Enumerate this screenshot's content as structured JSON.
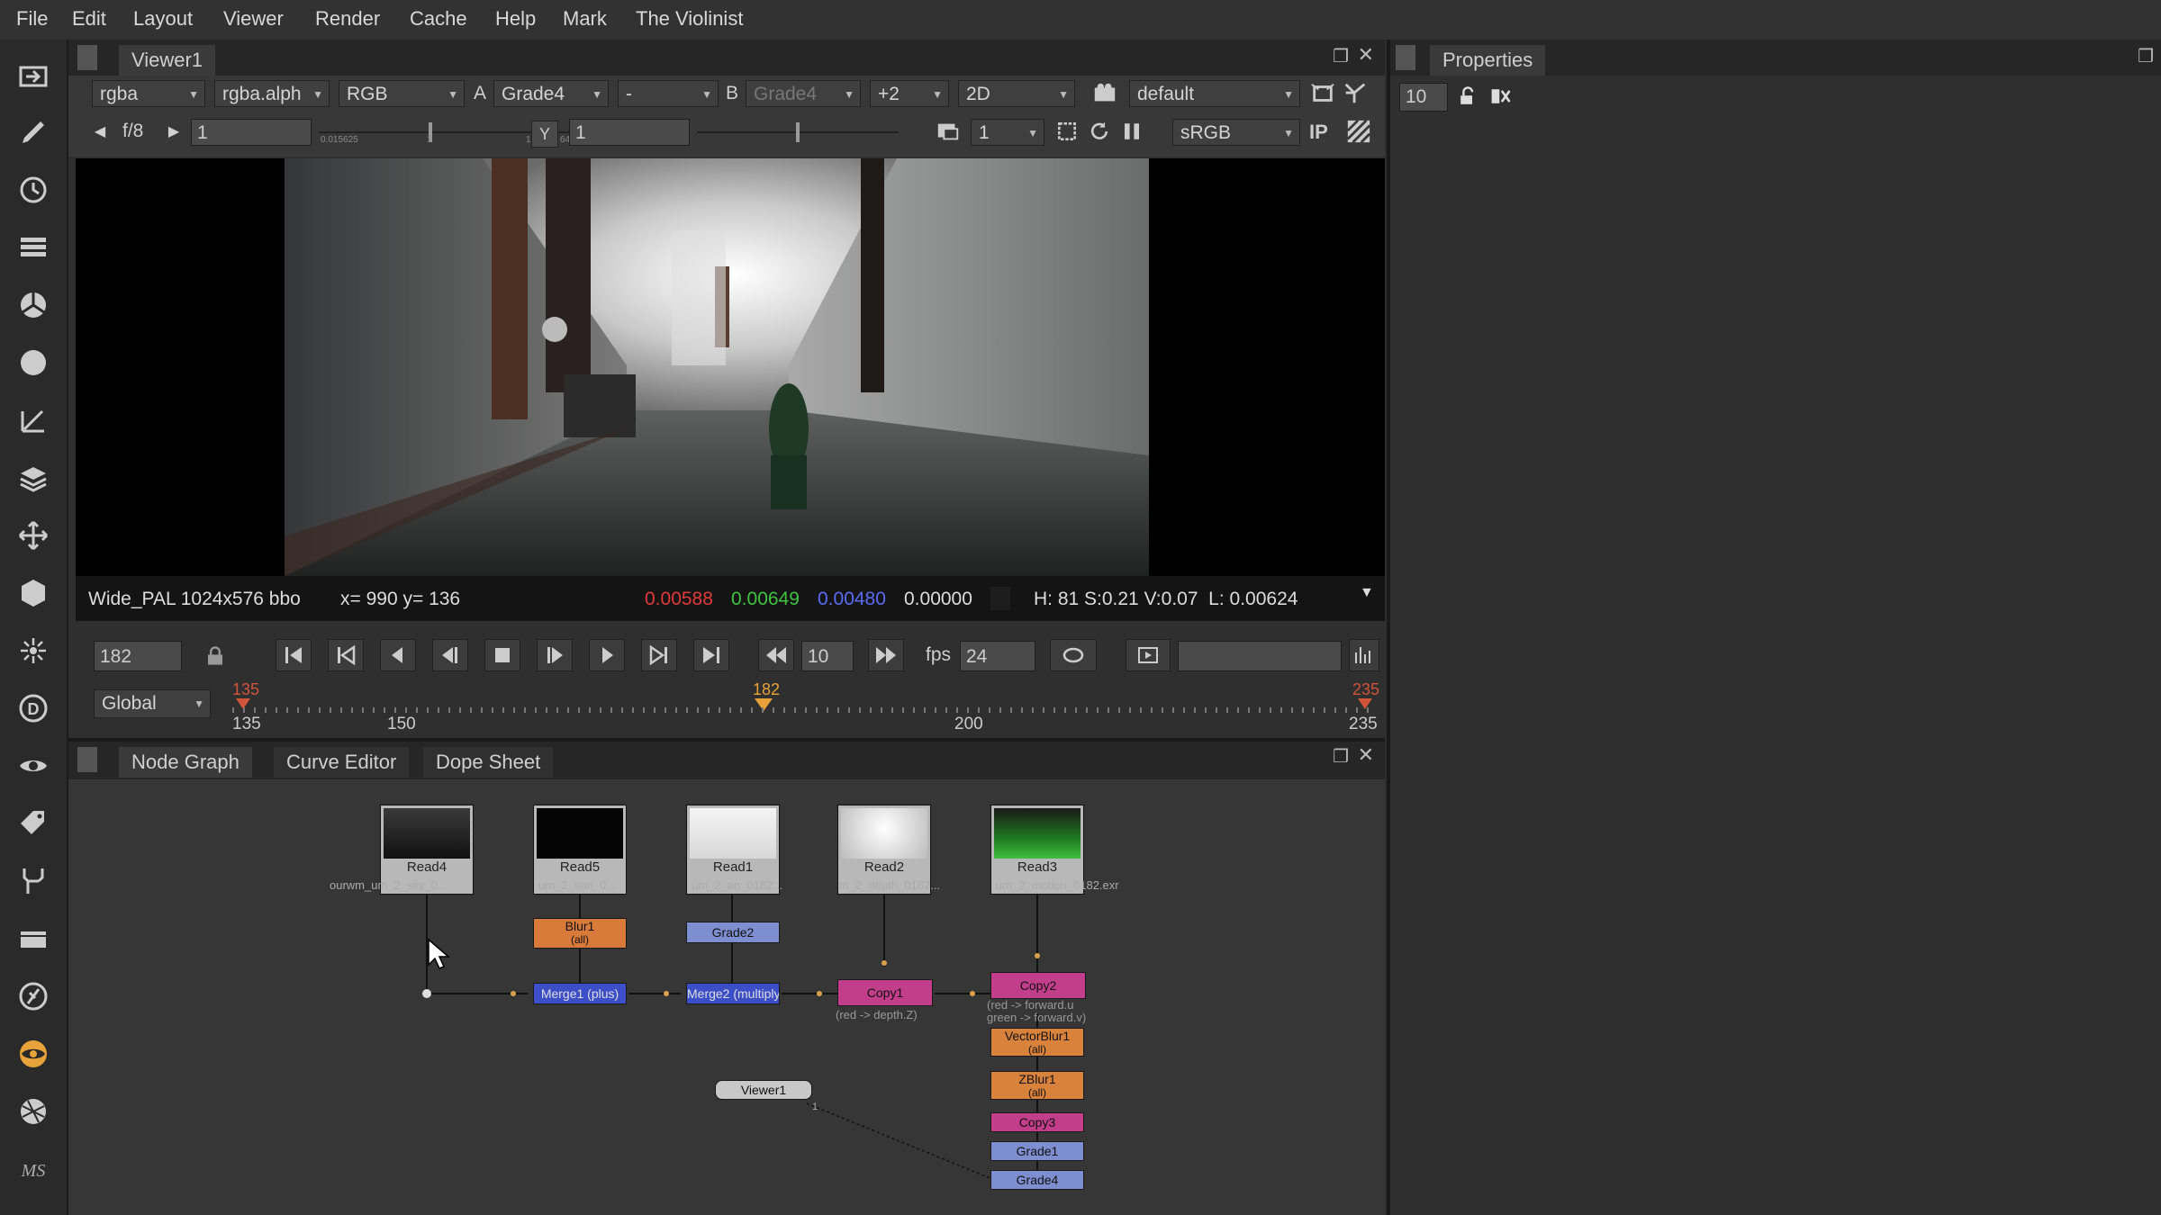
{
  "menu": [
    "File",
    "Edit",
    "Layout",
    "Viewer",
    "Render",
    "Cache",
    "Help",
    "Mark",
    "The Violinist"
  ],
  "viewer": {
    "tab": "Viewer1",
    "row1": {
      "channels": "rgba",
      "alpha": "rgba.alph",
      "display": "RGB",
      "a_label": "A",
      "a_input": "Grade4",
      "comp": "-",
      "b_label": "B",
      "b_input": "Grade4",
      "downrez": "+2",
      "view_mode": "2D",
      "lut_view": "default"
    },
    "row2": {
      "fstop": "f/8",
      "gain": "1",
      "gain_ticks": [
        "0.015625",
        "1",
        "16",
        "64"
      ],
      "y_label": "Y",
      "gamma": "1",
      "proxy": "1",
      "colorspace": "sRGB",
      "ip": "IP"
    },
    "status": {
      "format": "Wide_PAL 1024x576 bbo",
      "coords": "x= 990 y= 136",
      "r": "0.00588",
      "g": "0.00649",
      "b": "0.00480",
      "a": "0.00000",
      "hsvl": "H: 81 S:0.21 V:0.07  L: 0.00624"
    }
  },
  "timeline": {
    "frame": "182",
    "increment": "10",
    "fps_label": "fps",
    "fps": "24",
    "scope": "Global",
    "in_mark": "135",
    "current": "182",
    "out_mark": "235",
    "ticks": [
      "135",
      "150",
      "200",
      "235"
    ]
  },
  "properties": {
    "tab": "Properties",
    "max_panels": "10"
  },
  "nodegraph": {
    "tabs": [
      "Node Graph",
      "Curve Editor",
      "Dope Sheet"
    ],
    "reads": [
      {
        "name": "Read4",
        "sub": "ourwm_um_2_sky_0..."
      },
      {
        "name": "Read5",
        "sub": "um_2_sun_0..."
      },
      {
        "name": "Read1",
        "sub": "um_2_ao_0182..."
      },
      {
        "name": "Read2",
        "sub": "m_2_depth_0182..."
      },
      {
        "name": "Read3",
        "sub": "um_2_motion_0182.exr"
      }
    ],
    "nodes": {
      "blur1": "Blur1",
      "blur1_sub": "(all)",
      "grade2": "Grade2",
      "merge1": "Merge1 (plus)",
      "merge2": "Merge2 (multiply)",
      "copy1": "Copy1",
      "copy1_sub": "(red -> depth.Z)",
      "copy2": "Copy2",
      "copy2_sub": "(red -> forward.u\ngreen -> forward.v)",
      "vectorblur1": "VectorBlur1",
      "vectorblur1_sub": "(all)",
      "zblur1": "ZBlur1",
      "zblur1_sub": "(all)",
      "copy3": "Copy3",
      "grade1": "Grade1",
      "grade4": "Grade4",
      "viewer1": "Viewer1",
      "viewer_input": "1"
    }
  },
  "colors": {
    "accent": "#e8a23a",
    "red": "#e03a3a",
    "green": "#3ec43e",
    "blue": "#4a5cf0",
    "blur_node": "#d77a3a",
    "grade_node": "#7d8fd0",
    "merge_node": "#3d4fc8",
    "copy_node": "#c23d8a",
    "vblur_node": "#d9823c"
  }
}
